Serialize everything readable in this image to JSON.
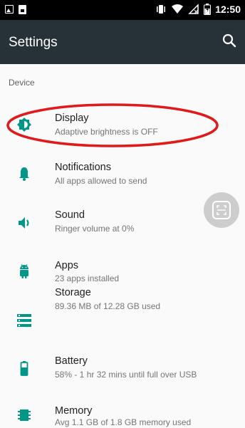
{
  "status_bar": {
    "time": "12:50",
    "left_icons": [
      "image-notification-icon",
      "document-notification-icon"
    ],
    "right_icons": [
      "vibrate-icon",
      "wifi-icon",
      "signal-icon",
      "battery-icon"
    ]
  },
  "app_bar": {
    "title": "Settings",
    "search_icon": "search-icon"
  },
  "section": {
    "header": "Device"
  },
  "items": [
    {
      "title": "Display",
      "summary": "Adaptive brightness is OFF",
      "icon": "brightness-icon"
    },
    {
      "title": "Notifications",
      "summary": "All apps allowed to send",
      "icon": "bell-icon"
    },
    {
      "title": "Sound",
      "summary": "Ringer volume at 0%",
      "icon": "volume-icon"
    },
    {
      "title": "Apps",
      "summary": "23 apps installed",
      "icon": "android-icon"
    },
    {
      "title": "Storage",
      "summary": "89.36 MB of 12.28 GB used",
      "icon": "storage-icon"
    },
    {
      "title": "Battery",
      "summary": "58% - 1 hr 32 mins until full over USB",
      "icon": "battery-icon"
    },
    {
      "title": "Memory",
      "summary": "Avg 1.1 GB of 1.8 GB memory used",
      "icon": "memory-chip-icon"
    }
  ],
  "colors": {
    "accent": "#009688",
    "app_bar": "#263238",
    "highlight": "#e0191b",
    "background": "#fafafa"
  }
}
